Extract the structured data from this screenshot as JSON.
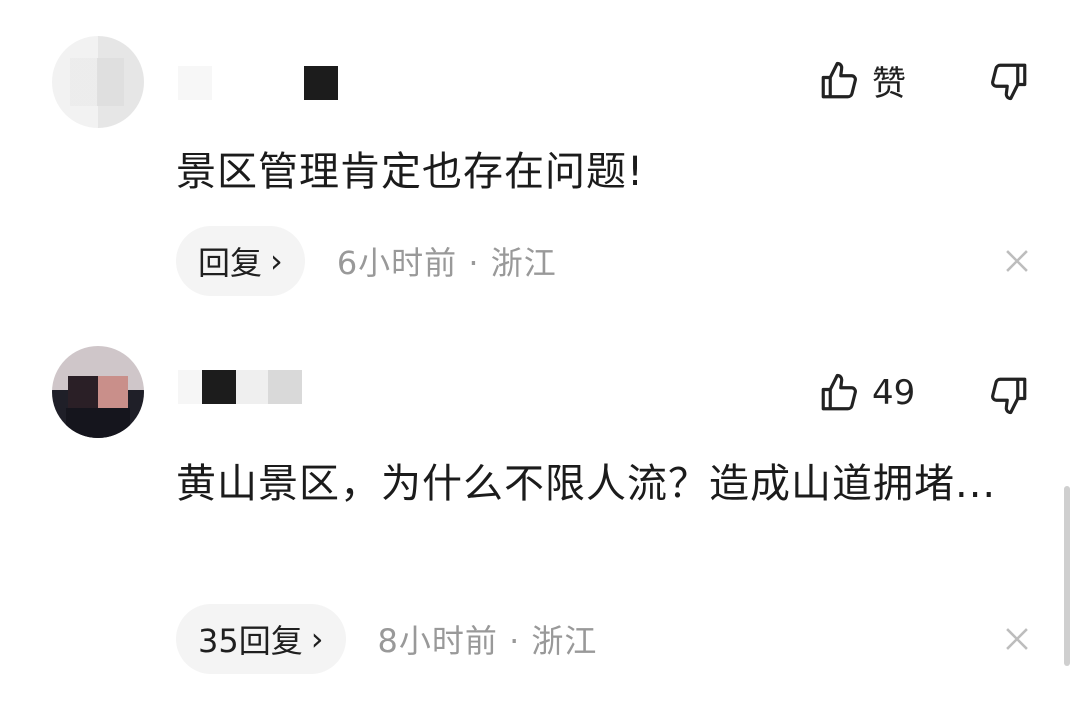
{
  "comments": [
    {
      "like_label": "赞",
      "text": "景区管理肯定也存在问题!",
      "reply_label": "回复",
      "reply_chevron": "›",
      "time_location": "6小时前 · 浙江"
    },
    {
      "like_label": "49",
      "text": "黄山景区，为什么不限人流？造成山道拥堵...",
      "reply_label": "35回复",
      "reply_chevron": "›",
      "time_location": "8小时前 · 浙江"
    }
  ],
  "colors": {
    "meta_text": "#999999",
    "reply_bg": "#f4f4f4",
    "scrollbar": "#cfcfcf"
  },
  "icons": [
    "thumb-up-icon",
    "thumb-down-icon",
    "close-icon",
    "chevron-right-icon"
  ]
}
